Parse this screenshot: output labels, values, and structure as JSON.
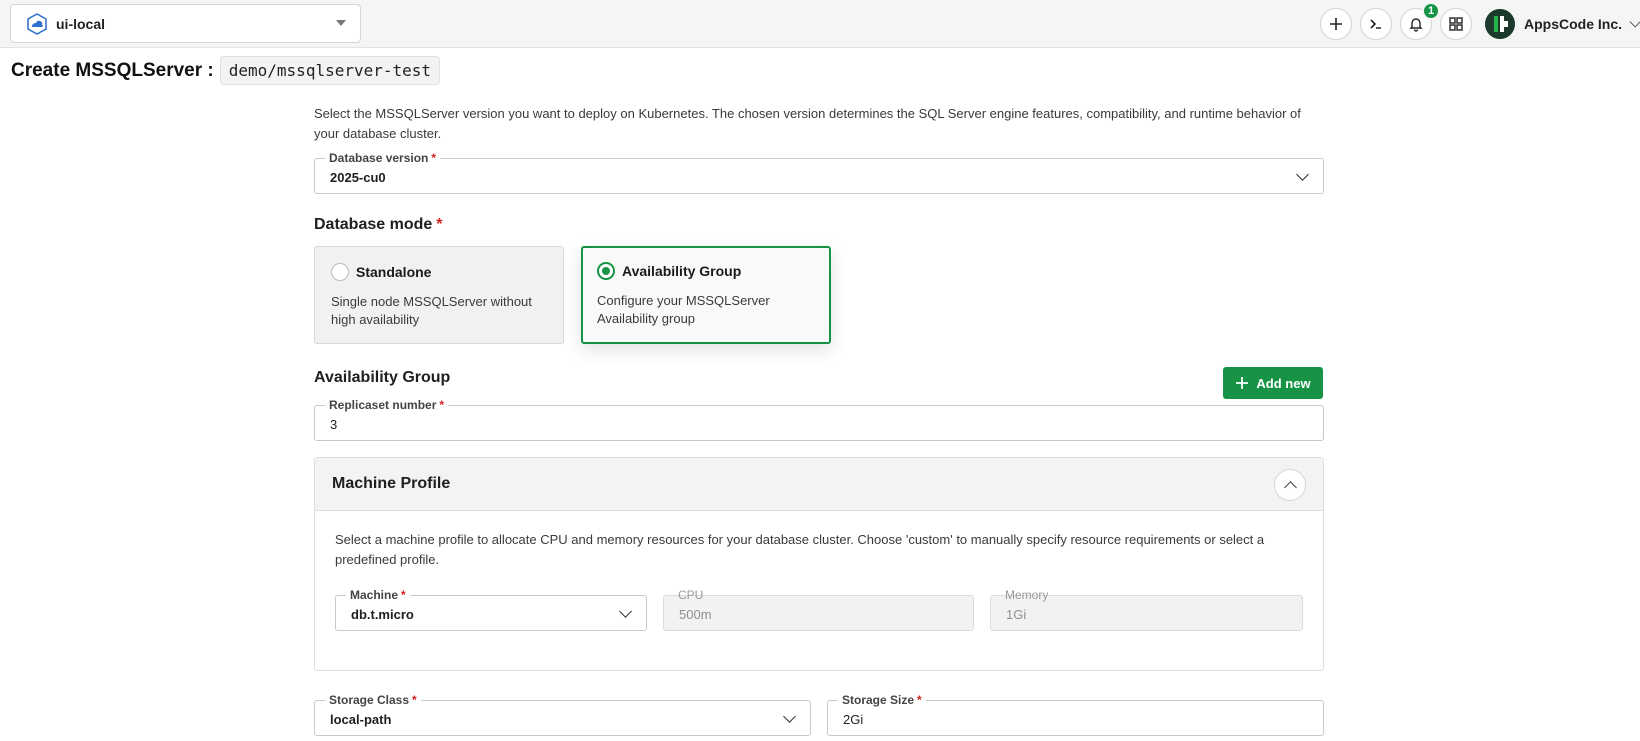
{
  "topbar": {
    "cluster_name": "ui-local",
    "add_icon": "plus-icon",
    "terminal_icon": "terminal-icon",
    "notification_icon": "bell-icon",
    "notification_count": "1",
    "apps_icon": "grid-icon",
    "org_name": "AppsCode Inc."
  },
  "header": {
    "title": "Create MSSQLServer :",
    "resource": "demo/mssqlserver-test"
  },
  "version": {
    "description": "Select the MSSQLServer version you want to deploy on Kubernetes. The chosen version determines the SQL Server engine features, compatibility, and runtime behavior of your database cluster.",
    "label": "Database version",
    "required": "*",
    "value": "2025-cu0"
  },
  "mode": {
    "title": "Database mode",
    "required": "*",
    "options": [
      {
        "name": "Standalone",
        "description": "Single node MSSQLServer without high availability",
        "selected": false
      },
      {
        "name": "Availability Group",
        "description": "Configure your MSSQLServer Availability group",
        "selected": true
      }
    ]
  },
  "availability_group": {
    "title": "Availability Group",
    "add_label": "Add new",
    "replicaset_label": "Replicaset number",
    "required": "*",
    "replicaset_value": "3"
  },
  "machine_profile": {
    "title": "Machine Profile",
    "description": "Select a machine profile to allocate CPU and memory resources for your database cluster. Choose 'custom' to manually specify resource requirements or select a predefined profile.",
    "machine_label": "Machine",
    "required": "*",
    "machine_value": "db.t.micro",
    "cpu_label": "CPU",
    "cpu_value": "500m",
    "memory_label": "Memory",
    "memory_value": "1Gi"
  },
  "storage": {
    "class_label": "Storage Class",
    "class_value": "local-path",
    "size_label": "Storage Size",
    "size_value": "2Gi",
    "required": "*"
  },
  "colors": {
    "accent": "#169344",
    "required": "#d62020"
  }
}
